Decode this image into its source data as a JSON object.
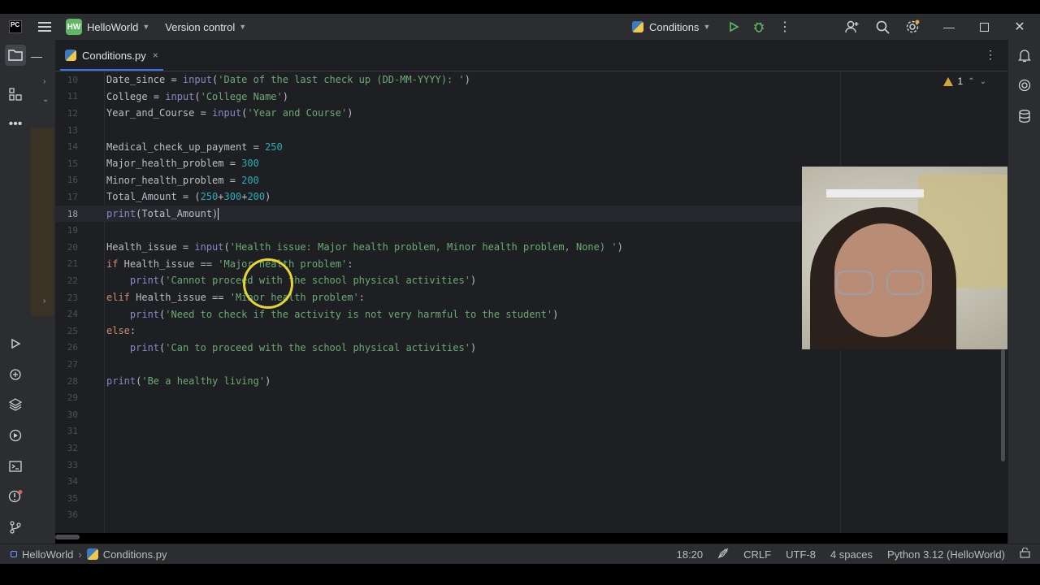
{
  "titlebar": {
    "logo": "PC",
    "project_badge": "HW",
    "project_name": "HelloWorld",
    "version_control": "Version control",
    "run_config": "Conditions"
  },
  "tab": {
    "label": "Conditions.py",
    "close": "×"
  },
  "editor": {
    "warning_count": "1",
    "lines": [
      {
        "num": "10"
      },
      {
        "num": "11"
      },
      {
        "num": "12"
      },
      {
        "num": "13"
      },
      {
        "num": "14"
      },
      {
        "num": "15"
      },
      {
        "num": "16"
      },
      {
        "num": "17"
      },
      {
        "num": "18"
      },
      {
        "num": "19"
      },
      {
        "num": "20"
      },
      {
        "num": "21"
      },
      {
        "num": "22"
      },
      {
        "num": "23"
      },
      {
        "num": "24"
      },
      {
        "num": "25"
      },
      {
        "num": "26"
      },
      {
        "num": "27"
      },
      {
        "num": "28"
      },
      {
        "num": "29"
      },
      {
        "num": "30"
      },
      {
        "num": "31"
      },
      {
        "num": "32"
      },
      {
        "num": "33"
      },
      {
        "num": "34"
      },
      {
        "num": "35"
      },
      {
        "num": "36"
      }
    ],
    "code": {
      "l10": [
        "Date_since = ",
        "input",
        "(",
        "'Date of the last check up (DD-MM-YYYY): '",
        ")"
      ],
      "l11": [
        "College = ",
        "input",
        "(",
        "'College Name'",
        ")"
      ],
      "l12": [
        "Year_and_Course = ",
        "input",
        "(",
        "'Year and Course'",
        ")"
      ],
      "l14": [
        "Medical_check_up_payment = ",
        "250"
      ],
      "l15": [
        "Major_health_problem = ",
        "300"
      ],
      "l16": [
        "Minor_health_problem = ",
        "200"
      ],
      "l17": [
        "Total_Amount = (",
        "250",
        "+",
        "300",
        "+",
        "200",
        ")"
      ],
      "l18": [
        "print",
        "(Total_Amount)"
      ],
      "l20": [
        "Health_issue = ",
        "input",
        "(",
        "'Health issue: Major health problem, Minor health problem, None) '",
        ")"
      ],
      "l21": [
        "if",
        " Health_issue == ",
        "'Major health problem'",
        ":"
      ],
      "l22": [
        "    ",
        "print",
        "(",
        "'Cannot proceed with the school physical activities'",
        ")"
      ],
      "l23": [
        "elif",
        " Health_issue == ",
        "'Minor health problem'",
        ":"
      ],
      "l24": [
        "    ",
        "print",
        "(",
        "'Need to check if the activity is not very harmful to the student'",
        ")"
      ],
      "l25": [
        "else",
        ":"
      ],
      "l26": [
        "    ",
        "print",
        "(",
        "'Can to proceed with the school physical activities'",
        ")"
      ],
      "l28": [
        "print",
        "(",
        "'Be a healthy living'",
        ")"
      ]
    }
  },
  "statusbar": {
    "project": "HelloWorld",
    "file": "Conditions.py",
    "position": "18:20",
    "line_sep": "CRLF",
    "encoding": "UTF-8",
    "indent": "4 spaces",
    "interpreter": "Python 3.12 (HelloWorld)"
  },
  "colors": {
    "accent": "#3574f0",
    "keyword": "#cf8e6d",
    "string": "#6aab73",
    "number": "#2aacb8",
    "builtin": "#8888c6"
  }
}
